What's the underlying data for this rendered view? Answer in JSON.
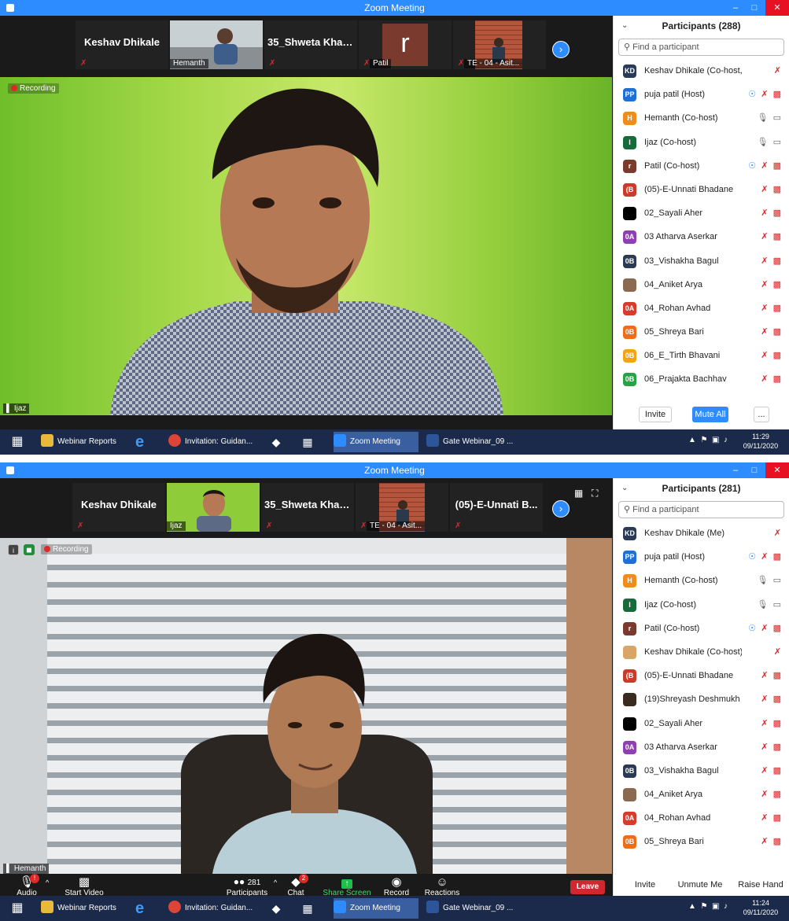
{
  "shot1": {
    "window_title": "Zoom Meeting",
    "strip": [
      {
        "name": "Keshav Dhikale"
      },
      {
        "caption": "Hemanth"
      },
      {
        "name": "35_Shweta Khar..."
      },
      {
        "letter": "r",
        "caption": "Patil"
      },
      {
        "caption": "TE - 04 - Asit..."
      }
    ],
    "recording_label": "Recording",
    "speaker_caption": "Ijaz",
    "participants": {
      "title": "Participants (288)",
      "search_placeholder": "Find a participant",
      "items": [
        {
          "initials": "KD",
          "color": "#2b3a55",
          "name": "Keshav Dhikale (Co-host, me)",
          "status": "muted"
        },
        {
          "initials": "PP",
          "color": "#1f6fd6",
          "name": "puja patil (Host)",
          "status": "host"
        },
        {
          "initials": "H",
          "color": "#f28c16",
          "name": "Hemanth (Co-host)",
          "status": "video"
        },
        {
          "initials": "I",
          "color": "#176b3b",
          "name": "Ijaz (Co-host)",
          "status": "video"
        },
        {
          "initials": "r",
          "color": "#7a3a2e",
          "name": "Patil (Co-host)",
          "status": "host"
        },
        {
          "initials": "(B",
          "color": "#c93b2b",
          "name": "(05)-E-Unnati Bhadane",
          "status": "off"
        },
        {
          "initials": "",
          "color": "#000000",
          "name": "02_Sayali Aher",
          "status": "off"
        },
        {
          "initials": "0A",
          "color": "#8e3fb3",
          "name": "03 Atharva Aserkar",
          "status": "off"
        },
        {
          "initials": "0B",
          "color": "#2b3a55",
          "name": "03_Vishakha Bagul",
          "status": "off"
        },
        {
          "initials": "",
          "color": "#8a6a50",
          "name": "04_Aniket Arya",
          "status": "off"
        },
        {
          "initials": "0A",
          "color": "#d63b2b",
          "name": "04_Rohan Avhad",
          "status": "off"
        },
        {
          "initials": "0B",
          "color": "#f06c16",
          "name": "05_Shreya Bari",
          "status": "off"
        },
        {
          "initials": "0B",
          "color": "#f5a316",
          "name": "06_E_Tirth Bhavani",
          "status": "off"
        },
        {
          "initials": "0B",
          "color": "#27a346",
          "name": "06_Prajakta Bachhav",
          "status": "off"
        }
      ],
      "buttons": {
        "invite": "Invite",
        "mute_all": "Mute All",
        "more": "..."
      }
    },
    "taskbar": {
      "items": [
        "Webinar Reports",
        "Invitation: Guidan...",
        "Zoom Meeting",
        "Gate Webinar_09 ..."
      ],
      "time": "11:29",
      "date": "09/11/2020"
    }
  },
  "shot2": {
    "window_title": "Zoom Meeting",
    "strip": [
      {
        "name": "Keshav Dhikale"
      },
      {
        "caption": "Ijaz"
      },
      {
        "name": "35_Shweta Khar..."
      },
      {
        "caption": "TE - 04 - Asit..."
      },
      {
        "name": "(05)-E-Unnati B..."
      }
    ],
    "recording_label": "Recording",
    "speaker_caption": "Hemanth",
    "participants": {
      "title": "Participants (281)",
      "search_placeholder": "Find a participant",
      "items": [
        {
          "initials": "KD",
          "color": "#2b3a55",
          "name": "Keshav Dhikale (Me)",
          "status": "muted"
        },
        {
          "initials": "PP",
          "color": "#1f6fd6",
          "name": "puja patil (Host)",
          "status": "host"
        },
        {
          "initials": "H",
          "color": "#f28c16",
          "name": "Hemanth (Co-host)",
          "status": "video"
        },
        {
          "initials": "I",
          "color": "#176b3b",
          "name": "Ijaz (Co-host)",
          "status": "video"
        },
        {
          "initials": "r",
          "color": "#7a3a2e",
          "name": "Patil (Co-host)",
          "status": "host"
        },
        {
          "initials": "",
          "color": "#d9a566",
          "name": "Keshav Dhikale (Co-host)",
          "status": "muted"
        },
        {
          "initials": "(B",
          "color": "#c93b2b",
          "name": "(05)-E-Unnati Bhadane",
          "status": "off"
        },
        {
          "initials": "",
          "color": "#3a2a20",
          "name": "(19)Shreyash Deshmukh",
          "status": "off"
        },
        {
          "initials": "",
          "color": "#000000",
          "name": "02_Sayali Aher",
          "status": "off"
        },
        {
          "initials": "0A",
          "color": "#8e3fb3",
          "name": "03 Atharva Aserkar",
          "status": "off"
        },
        {
          "initials": "0B",
          "color": "#2b3a55",
          "name": "03_Vishakha Bagul",
          "status": "off"
        },
        {
          "initials": "",
          "color": "#8a6a50",
          "name": "04_Aniket Arya",
          "status": "off"
        },
        {
          "initials": "0A",
          "color": "#d63b2b",
          "name": "04_Rohan Avhad",
          "status": "off"
        },
        {
          "initials": "0B",
          "color": "#f06c16",
          "name": "05_Shreya Bari",
          "status": "off"
        }
      ],
      "buttons": {
        "invite": "Invite",
        "unmute_me": "Unmute Me",
        "raise_hand": "Raise Hand"
      }
    },
    "toolbar": {
      "audio": "Audio",
      "start_video": "Start Video",
      "participants": "Participants",
      "participants_count": "281",
      "chat": "Chat",
      "chat_badge": "2",
      "share_screen": "Share Screen",
      "record": "Record",
      "reactions": "Reactions",
      "leave": "Leave"
    },
    "taskbar": {
      "items": [
        "Webinar Reports",
        "Invitation: Guidan...",
        "Zoom Meeting",
        "Gate Webinar_09 ..."
      ],
      "time": "11:24",
      "date": "09/11/2020"
    }
  },
  "colors": {
    "zoom_blue": "#2d8cff",
    "mute_red": "#e02828",
    "leave_red": "#d0282e",
    "taskbar": "#1b2a4a"
  }
}
